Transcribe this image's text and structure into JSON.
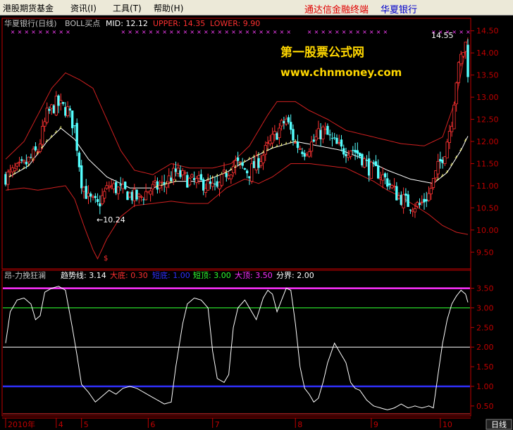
{
  "menubar": {
    "items": [
      "港股期货基金",
      "资讯(I)",
      "工具(T)",
      "帮助(H)"
    ],
    "terminal_name": "通达信金融终端",
    "stock_name": "华夏银行",
    "terminal_color": "#e00000",
    "stock_color": "#0000cc"
  },
  "main_panel": {
    "title": "华夏银行(日线)",
    "indicator": "BOLL买点",
    "mid_label": "MID: 12.12",
    "upper_label": "UPPER: 14.35",
    "lower_label": "LOWER: 9.90",
    "watermark_line1": "第一股票公式网",
    "watermark_line2": "www.chnmoney.com",
    "low_annotation": "←10.24",
    "high_annotation": "14.55",
    "bottom_marker": "$"
  },
  "sub_panel": {
    "title": "昂-力挽狂澜",
    "legend": [
      {
        "label": "趋势线: 3.14",
        "color": "#ffffff"
      },
      {
        "label": "大底: 0.30",
        "color": "#ff3030"
      },
      {
        "label": "短底: 1.00",
        "color": "#3030ff"
      },
      {
        "label": "短顶: 3.00",
        "color": "#30ff30"
      },
      {
        "label": "大顶: 3.50",
        "color": "#ff30ff"
      },
      {
        "label": "分界: 2.00",
        "color": "#ffffff"
      }
    ]
  },
  "date_axis": {
    "labels": [
      {
        "text": "2010年",
        "index": 0
      },
      {
        "text": "4",
        "index": 22
      },
      {
        "text": "5",
        "index": 33
      },
      {
        "text": "6",
        "index": 62
      },
      {
        "text": "7",
        "index": 90
      },
      {
        "text": "8",
        "index": 126
      },
      {
        "text": "9",
        "index": 159
      },
      {
        "text": "10",
        "index": 189
      }
    ],
    "period_button": "日线"
  },
  "chart_data": [
    {
      "type": "candlestick",
      "y_ticks": [
        14.5,
        14.0,
        13.5,
        13.0,
        12.5,
        12.0,
        11.5,
        11.0,
        10.5,
        10.0,
        9.5
      ],
      "ylim": [
        9.25,
        14.75
      ],
      "n_bars": 202,
      "close_anchors": [
        [
          0,
          11.2
        ],
        [
          8,
          11.45
        ],
        [
          14,
          11.8
        ],
        [
          18,
          12.6
        ],
        [
          22,
          12.85
        ],
        [
          27,
          12.7
        ],
        [
          30,
          12.3
        ],
        [
          33,
          11.1
        ],
        [
          36,
          10.7
        ],
        [
          40,
          10.55
        ],
        [
          45,
          11.0
        ],
        [
          52,
          10.85
        ],
        [
          58,
          10.7
        ],
        [
          62,
          10.9
        ],
        [
          68,
          11.0
        ],
        [
          74,
          11.3
        ],
        [
          80,
          11.1
        ],
        [
          86,
          11.05
        ],
        [
          92,
          10.9
        ],
        [
          96,
          11.3
        ],
        [
          100,
          11.5
        ],
        [
          106,
          11.3
        ],
        [
          112,
          11.7
        ],
        [
          118,
          12.2
        ],
        [
          122,
          12.5
        ],
        [
          126,
          11.95
        ],
        [
          130,
          11.8
        ],
        [
          134,
          12.0
        ],
        [
          138,
          12.25
        ],
        [
          142,
          12.0
        ],
        [
          146,
          11.8
        ],
        [
          150,
          11.85
        ],
        [
          154,
          11.7
        ],
        [
          158,
          11.4
        ],
        [
          162,
          11.3
        ],
        [
          166,
          11.1
        ],
        [
          170,
          10.8
        ],
        [
          175,
          10.6
        ],
        [
          180,
          10.55
        ],
        [
          184,
          10.8
        ],
        [
          188,
          11.4
        ],
        [
          191,
          11.8
        ],
        [
          194,
          12.5
        ],
        [
          196,
          13.4
        ],
        [
          198,
          13.9
        ],
        [
          200,
          14.2
        ],
        [
          201,
          13.6
        ]
      ],
      "mid_anchors": [
        [
          0,
          11.15
        ],
        [
          10,
          11.45
        ],
        [
          18,
          12.0
        ],
        [
          24,
          12.3
        ],
        [
          30,
          12.05
        ],
        [
          36,
          11.6
        ],
        [
          44,
          11.2
        ],
        [
          54,
          10.95
        ],
        [
          64,
          10.95
        ],
        [
          74,
          11.1
        ],
        [
          86,
          11.1
        ],
        [
          96,
          11.3
        ],
        [
          106,
          11.6
        ],
        [
          116,
          11.85
        ],
        [
          126,
          12.0
        ],
        [
          136,
          11.9
        ],
        [
          146,
          11.8
        ],
        [
          156,
          11.6
        ],
        [
          166,
          11.35
        ],
        [
          176,
          11.15
        ],
        [
          186,
          11.05
        ],
        [
          192,
          11.3
        ],
        [
          198,
          11.8
        ],
        [
          201,
          12.12
        ]
      ],
      "upper_anchors": [
        [
          0,
          11.6
        ],
        [
          8,
          12.0
        ],
        [
          14,
          12.6
        ],
        [
          20,
          13.2
        ],
        [
          26,
          13.55
        ],
        [
          32,
          13.4
        ],
        [
          38,
          13.2
        ],
        [
          44,
          12.5
        ],
        [
          50,
          11.8
        ],
        [
          56,
          11.35
        ],
        [
          64,
          11.25
        ],
        [
          72,
          11.5
        ],
        [
          80,
          11.4
        ],
        [
          90,
          11.4
        ],
        [
          98,
          11.5
        ],
        [
          106,
          11.9
        ],
        [
          114,
          12.6
        ],
        [
          118,
          12.9
        ],
        [
          126,
          12.9
        ],
        [
          132,
          12.7
        ],
        [
          140,
          12.5
        ],
        [
          148,
          12.25
        ],
        [
          156,
          12.15
        ],
        [
          164,
          12.05
        ],
        [
          172,
          11.95
        ],
        [
          182,
          11.9
        ],
        [
          190,
          12.1
        ],
        [
          196,
          13.0
        ],
        [
          201,
          14.35
        ]
      ],
      "lower_anchors": [
        [
          0,
          10.9
        ],
        [
          8,
          10.95
        ],
        [
          14,
          10.9
        ],
        [
          20,
          10.95
        ],
        [
          26,
          11.0
        ],
        [
          30,
          10.7
        ],
        [
          34,
          10.1
        ],
        [
          38,
          9.55
        ],
        [
          40,
          9.35
        ],
        [
          44,
          9.8
        ],
        [
          50,
          10.3
        ],
        [
          56,
          10.55
        ],
        [
          64,
          10.6
        ],
        [
          72,
          10.65
        ],
        [
          80,
          10.6
        ],
        [
          88,
          10.6
        ],
        [
          96,
          10.95
        ],
        [
          104,
          11.15
        ],
        [
          110,
          11.05
        ],
        [
          116,
          11.2
        ],
        [
          124,
          11.5
        ],
        [
          132,
          11.5
        ],
        [
          140,
          11.45
        ],
        [
          148,
          11.4
        ],
        [
          154,
          11.25
        ],
        [
          160,
          11.1
        ],
        [
          166,
          10.9
        ],
        [
          172,
          10.75
        ],
        [
          178,
          10.55
        ],
        [
          184,
          10.35
        ],
        [
          190,
          10.1
        ],
        [
          196,
          9.95
        ],
        [
          201,
          9.9
        ]
      ]
    },
    {
      "type": "line",
      "ylim": [
        0.3,
        3.6
      ],
      "y_ticks": [
        3.5,
        3.0,
        2.5,
        2.0,
        1.5,
        1.0,
        0.5
      ],
      "hlines": [
        {
          "name": "大底",
          "value": 0.3,
          "color": "#ff3030"
        },
        {
          "name": "短底",
          "value": 1.0,
          "color": "#3030ff"
        },
        {
          "name": "分界",
          "value": 2.0,
          "color": "#ffffff"
        },
        {
          "name": "短顶",
          "value": 3.0,
          "color": "#30ff30"
        },
        {
          "name": "大顶",
          "value": 3.5,
          "color": "#ff30ff"
        }
      ],
      "series_anchors": [
        [
          0,
          2.1
        ],
        [
          2,
          2.9
        ],
        [
          5,
          3.2
        ],
        [
          8,
          3.25
        ],
        [
          11,
          3.1
        ],
        [
          13,
          2.7
        ],
        [
          15,
          2.8
        ],
        [
          17,
          3.4
        ],
        [
          20,
          3.5
        ],
        [
          23,
          3.55
        ],
        [
          26,
          3.45
        ],
        [
          29,
          2.5
        ],
        [
          31,
          1.8
        ],
        [
          33,
          1.05
        ],
        [
          36,
          0.85
        ],
        [
          39,
          0.6
        ],
        [
          42,
          0.75
        ],
        [
          45,
          0.9
        ],
        [
          48,
          0.8
        ],
        [
          51,
          0.95
        ],
        [
          54,
          1.0
        ],
        [
          57,
          0.95
        ],
        [
          60,
          0.85
        ],
        [
          63,
          0.75
        ],
        [
          66,
          0.65
        ],
        [
          69,
          0.55
        ],
        [
          72,
          0.6
        ],
        [
          74,
          1.5
        ],
        [
          77,
          2.6
        ],
        [
          79,
          3.1
        ],
        [
          82,
          3.25
        ],
        [
          85,
          3.2
        ],
        [
          88,
          3.0
        ],
        [
          90,
          1.9
        ],
        [
          92,
          1.2
        ],
        [
          95,
          1.1
        ],
        [
          97,
          1.3
        ],
        [
          99,
          2.5
        ],
        [
          101,
          3.0
        ],
        [
          104,
          3.2
        ],
        [
          106,
          3.0
        ],
        [
          109,
          2.7
        ],
        [
          112,
          3.25
        ],
        [
          114,
          3.45
        ],
        [
          116,
          3.35
        ],
        [
          118,
          2.9
        ],
        [
          120,
          3.2
        ],
        [
          122,
          3.5
        ],
        [
          124,
          3.45
        ],
        [
          126,
          2.6
        ],
        [
          128,
          1.5
        ],
        [
          130,
          0.95
        ],
        [
          132,
          0.8
        ],
        [
          134,
          0.6
        ],
        [
          136,
          0.7
        ],
        [
          138,
          1.1
        ],
        [
          140,
          1.6
        ],
        [
          143,
          2.1
        ],
        [
          145,
          1.9
        ],
        [
          148,
          1.6
        ],
        [
          150,
          1.1
        ],
        [
          152,
          0.95
        ],
        [
          154,
          0.9
        ],
        [
          157,
          0.65
        ],
        [
          160,
          0.5
        ],
        [
          163,
          0.45
        ],
        [
          166,
          0.4
        ],
        [
          169,
          0.45
        ],
        [
          172,
          0.55
        ],
        [
          175,
          0.45
        ],
        [
          178,
          0.5
        ],
        [
          181,
          0.45
        ],
        [
          184,
          0.5
        ],
        [
          186,
          0.45
        ],
        [
          188,
          1.3
        ],
        [
          190,
          2.1
        ],
        [
          192,
          2.7
        ],
        [
          194,
          3.1
        ],
        [
          196,
          3.3
        ],
        [
          198,
          3.45
        ],
        [
          200,
          3.35
        ],
        [
          201,
          3.14
        ]
      ]
    }
  ]
}
